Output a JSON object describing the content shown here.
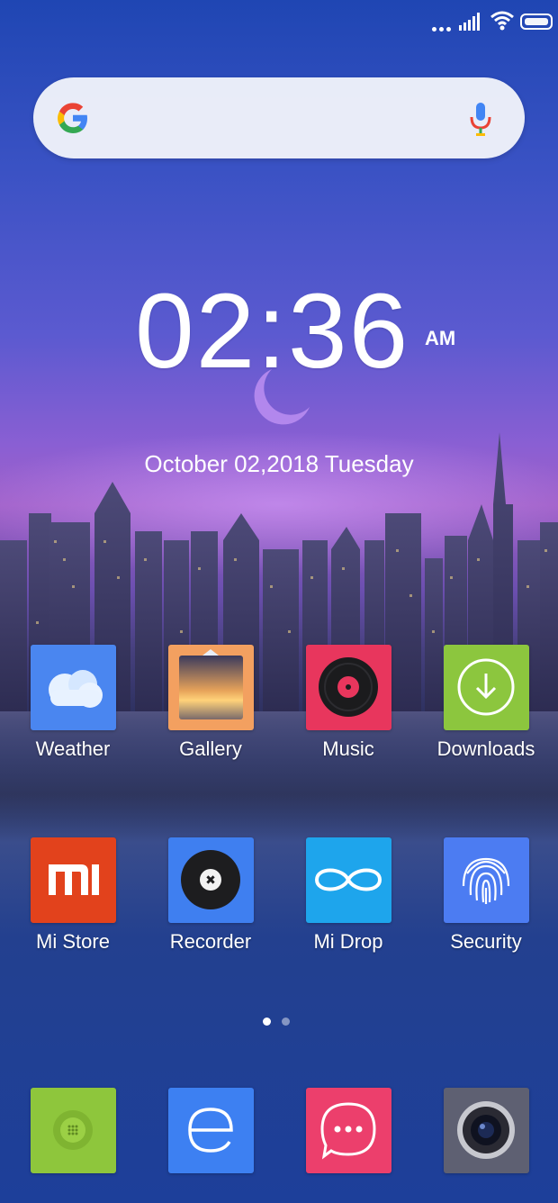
{
  "status_bar": {
    "icons": [
      "more-dots-icon",
      "signal-icon",
      "wifi-icon",
      "battery-icon"
    ]
  },
  "search_bar": {
    "icons": [
      "google-logo-icon",
      "microphone-icon"
    ]
  },
  "clock": {
    "time": "02:36",
    "ampm": "AM",
    "date": "October 02,2018 Tuesday",
    "weather_icon": "moon-icon"
  },
  "apps_row1": [
    {
      "label": "Weather",
      "icon": "cloud-icon",
      "color": "#4a86f0"
    },
    {
      "label": "Gallery",
      "icon": "photo-icon",
      "color": "#f3a060"
    },
    {
      "label": "Music",
      "icon": "vinyl-record-icon",
      "color": "#e8365d"
    },
    {
      "label": "Downloads",
      "icon": "download-icon",
      "color": "#8cc63e"
    }
  ],
  "apps_row2": [
    {
      "label": "Mi Store",
      "icon": "mi-logo-icon",
      "color": "#e2421c"
    },
    {
      "label": "Recorder",
      "icon": "record-disc-icon",
      "color": "#3f7ff0"
    },
    {
      "label": "Mi Drop",
      "icon": "infinity-icon",
      "color": "#1ea5ec"
    },
    {
      "label": "Security",
      "icon": "fingerprint-icon",
      "color": "#4c7cf2"
    }
  ],
  "dock": [
    {
      "icon": "phone-icon",
      "color": "#8ec63c"
    },
    {
      "icon": "browser-icon",
      "color": "#3d80f2"
    },
    {
      "icon": "messaging-icon",
      "color": "#ec3f6c"
    },
    {
      "icon": "camera-icon",
      "color": "#5e6072"
    }
  ],
  "pager": {
    "pages": 2,
    "active": 1
  }
}
